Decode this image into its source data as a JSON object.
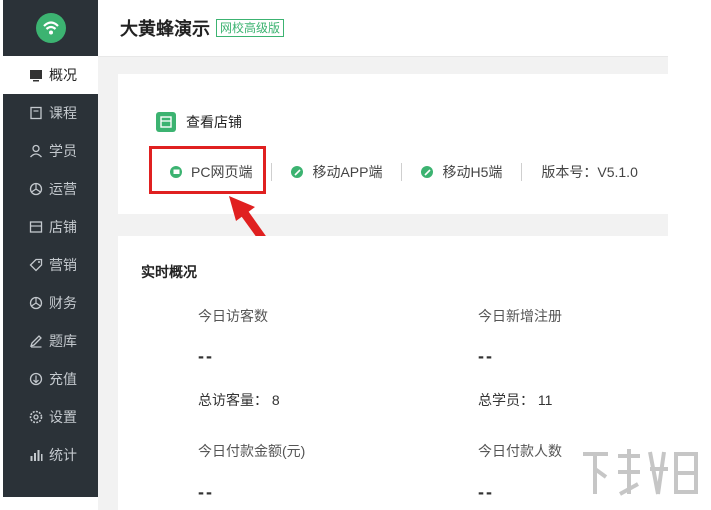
{
  "sidebar": {
    "items": [
      {
        "label": "概况",
        "icon": "dashboard-icon",
        "active": true
      },
      {
        "label": "课程",
        "icon": "course-icon",
        "active": false
      },
      {
        "label": "学员",
        "icon": "user-icon",
        "active": false
      },
      {
        "label": "运营",
        "icon": "operation-icon",
        "active": false
      },
      {
        "label": "店铺",
        "icon": "store-icon",
        "active": false
      },
      {
        "label": "营销",
        "icon": "tag-icon",
        "active": false
      },
      {
        "label": "财务",
        "icon": "finance-icon",
        "active": false
      },
      {
        "label": "题库",
        "icon": "pen-icon",
        "active": false
      },
      {
        "label": "充值",
        "icon": "recharge-icon",
        "active": false
      },
      {
        "label": "设置",
        "icon": "gear-icon",
        "active": false
      },
      {
        "label": "统计",
        "icon": "chart-icon",
        "active": false
      }
    ]
  },
  "header": {
    "title": "大黄蜂演示",
    "badge": "网校高级版"
  },
  "store": {
    "title": "查看店铺",
    "links": [
      {
        "label": "PC网页端"
      },
      {
        "label": "移动APP端"
      },
      {
        "label": "移动H5端"
      }
    ],
    "version_label": "版本号：V5.1.0"
  },
  "realtime": {
    "title": "实时概况",
    "visitors_today_label": "今日访客数",
    "visitors_today_value": "--",
    "new_registrations_label": "今日新增注册",
    "new_registrations_value": "--",
    "total_visits": "总访客量： 8",
    "total_students": "总学员： 11",
    "payment_amount_label": "今日付款金额(元)",
    "payment_amount_value": "--",
    "payers_label": "今日付款人数",
    "payers_value": "--"
  },
  "colors": {
    "sidebar_bg": "#2b3238",
    "accent": "#3cb371",
    "highlight": "#e02020"
  }
}
